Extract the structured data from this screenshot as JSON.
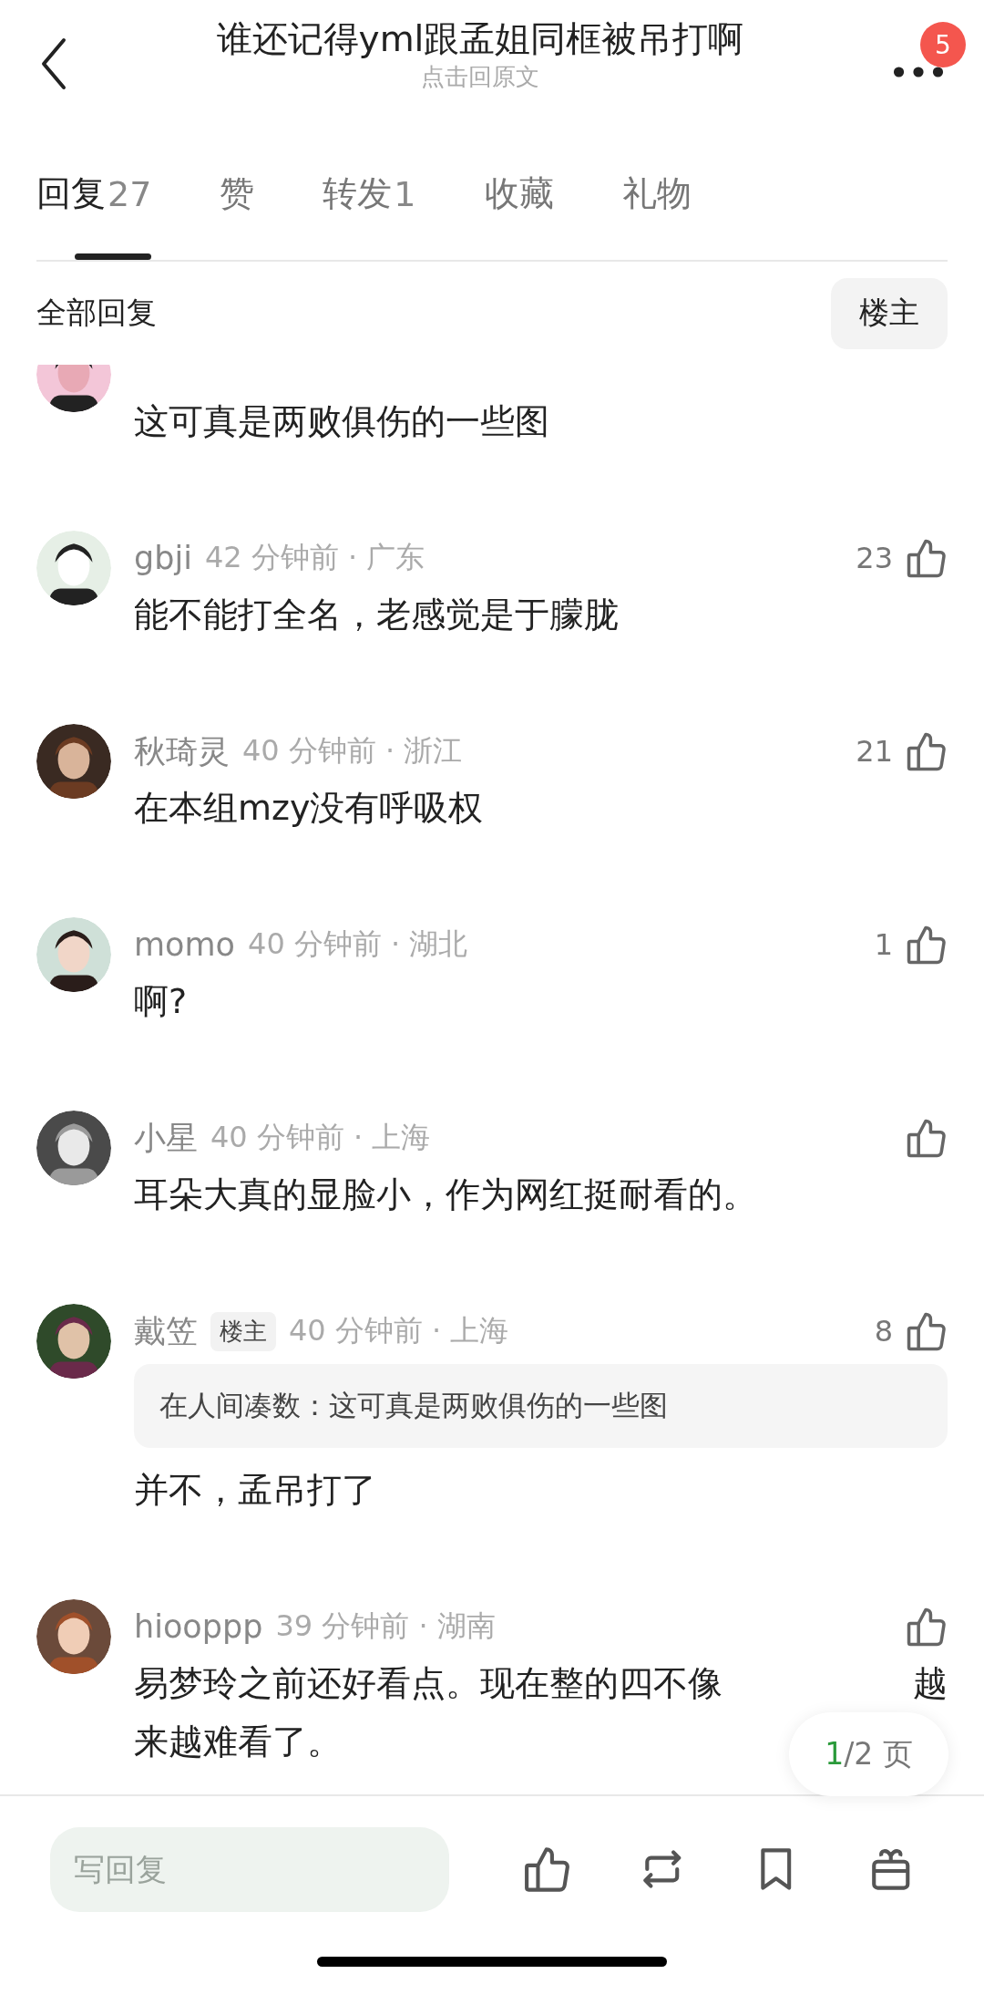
{
  "nav": {
    "title": "谁还记得yml跟孟姐同框被吊打啊",
    "subtitle": "点击回原文",
    "notification_count": "5"
  },
  "tabs": [
    {
      "label": "回复",
      "count": "27",
      "selected": true
    },
    {
      "label": "赞",
      "selected": false
    },
    {
      "label": "转发",
      "count": "1",
      "selected": false
    },
    {
      "label": "收藏",
      "selected": false
    },
    {
      "label": "礼物",
      "selected": false
    }
  ],
  "filter": {
    "label": "全部回复",
    "button": "楼主"
  },
  "comments": [
    {
      "kind": "partial",
      "avatar": {
        "kind": "picture"
      },
      "lines": [
        [
          "这可真是两败俱伤的一些图"
        ]
      ]
    },
    {
      "kind": "full",
      "avatar": {
        "kind": "picture"
      },
      "name": "gbji",
      "time": "42 分钟前 · 广东",
      "likes": "23",
      "lines": [
        [
          "能不能打全名，老感觉是于朦胧"
        ]
      ]
    },
    {
      "kind": "full",
      "avatar": {
        "kind": "picture"
      },
      "name": "秋琦灵",
      "time": "40 分钟前 · 浙江",
      "likes": "21",
      "lines": [
        [
          "在本组mzy没有呼吸权"
        ]
      ]
    },
    {
      "kind": "full",
      "avatar": {
        "kind": "picture"
      },
      "name": "momo",
      "time": "40 分钟前 · 湖北",
      "likes": "1",
      "lines": [
        [
          "啊?"
        ]
      ]
    },
    {
      "kind": "full",
      "avatar": {
        "kind": "picture"
      },
      "name": "小星",
      "time": "40 分钟前 · 上海",
      "lines": [
        [
          "耳朵大真的显脸小，作为网红挺耐看的。"
        ]
      ]
    },
    {
      "kind": "full",
      "avatar": {
        "kind": "picture"
      },
      "name": "戴笠",
      "badge": "楼主",
      "time": "40 分钟前 · 上海",
      "likes": "8",
      "quote": "在人间凑数：这可真是两败俱伤的一些图",
      "lines": [
        [
          "并不，孟吊打了"
        ]
      ]
    },
    {
      "kind": "full",
      "avatar": {
        "kind": "picture"
      },
      "name": "hiooppp",
      "time": "39 分钟前 · 湖南",
      "lines": [
        [
          "易梦玲之前还好看点。现在整的四不像",
          "越"
        ],
        [
          "来越难看了。"
        ]
      ]
    }
  ],
  "page_indicator": {
    "current": "1",
    "rest": "/2 页"
  },
  "reply_bar": {
    "placeholder": "写回复"
  }
}
